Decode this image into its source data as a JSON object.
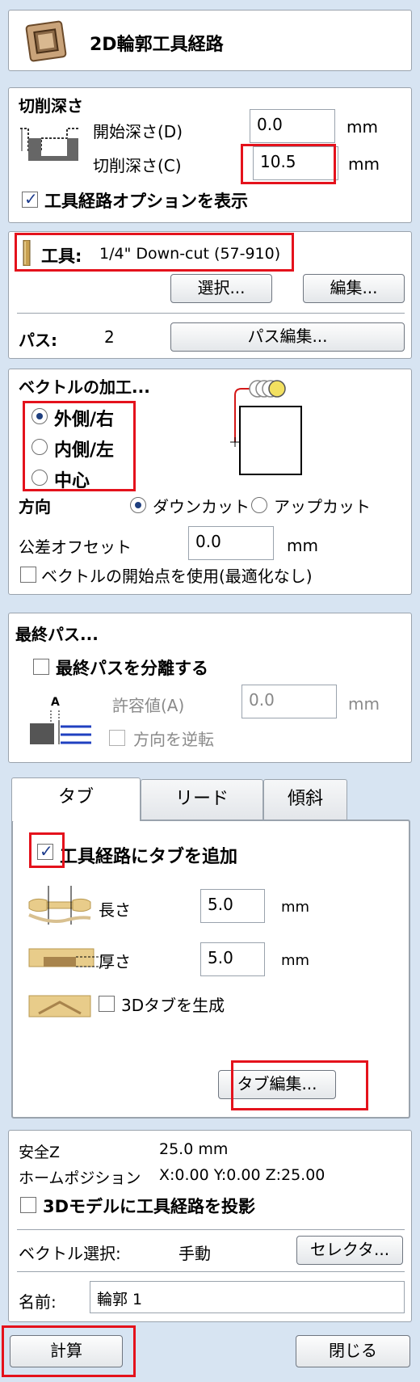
{
  "header": {
    "title": "2D輪郭工具経路",
    "icon": "profile-toolpath-icon"
  },
  "cut_depth": {
    "section_title": "切削深さ",
    "start_depth_label": "開始深さ(D)",
    "start_depth_value": "0.0",
    "cut_depth_label": "切削深さ(C)",
    "cut_depth_value": "10.5",
    "unit": "mm",
    "show_options_label": "工具経路オプションを表示",
    "show_options_checked": true
  },
  "tool": {
    "label": "工具:",
    "name": "1/4\" Down-cut (57-910)",
    "select_label": "選択...",
    "edit_label": "編集...",
    "passes_label": "パス:",
    "passes_value": "2",
    "edit_passes_label": "パス編集..."
  },
  "machine_vectors": {
    "section_title": "ベクトルの加工...",
    "outside_label": "外側/右",
    "inside_label": "内側/左",
    "on_label": "中心",
    "selected": "outside",
    "direction_label": "方向",
    "climb_label": "ダウンカット",
    "conventional_label": "アップカット",
    "direction_selected": "climb",
    "offset_label": "公差オフセット",
    "offset_value": "0.0",
    "unit": "mm",
    "use_start_label": "ベクトルの開始点を使用(最適化なし)",
    "use_start_checked": false
  },
  "last_pass": {
    "section_title": "最終パス...",
    "separate_label": "最終パスを分離する",
    "separate_checked": false,
    "allowance_label": "許容値(A)",
    "allowance_value": "0.0",
    "unit": "mm",
    "reverse_label": "方向を逆転",
    "reverse_checked": false
  },
  "tabs": {
    "items": [
      {
        "label": "タブ"
      },
      {
        "label": "リード"
      },
      {
        "label": "傾斜"
      }
    ],
    "active": 0,
    "add_tabs_label": "工具経路にタブを追加",
    "add_tabs_checked": true,
    "length_label": "長さ",
    "length_value": "5.0",
    "thickness_label": "厚さ",
    "thickness_value": "5.0",
    "unit": "mm",
    "create_3d_label": "3Dタブを生成",
    "create_3d_checked": false,
    "edit_tabs_label": "タブ編集..."
  },
  "bottom": {
    "safe_z_label": "安全Z",
    "safe_z_value": "25.0 mm",
    "home_label": "ホームポジション",
    "home_value": "X:0.00 Y:0.00 Z:25.00",
    "project_label": "3Dモデルに工具経路を投影",
    "project_checked": false,
    "vector_select_label": "ベクトル選択:",
    "vector_select_value": "手動",
    "selector_label": "セレクタ...",
    "name_label": "名前:",
    "name_value": "輪郭 1"
  },
  "footer": {
    "calculate_label": "計算",
    "close_label": "閉じる"
  },
  "colors": {
    "highlight": "#e4121c",
    "background": "#d7e4f2",
    "radio_dot": "#1f3f7f"
  }
}
